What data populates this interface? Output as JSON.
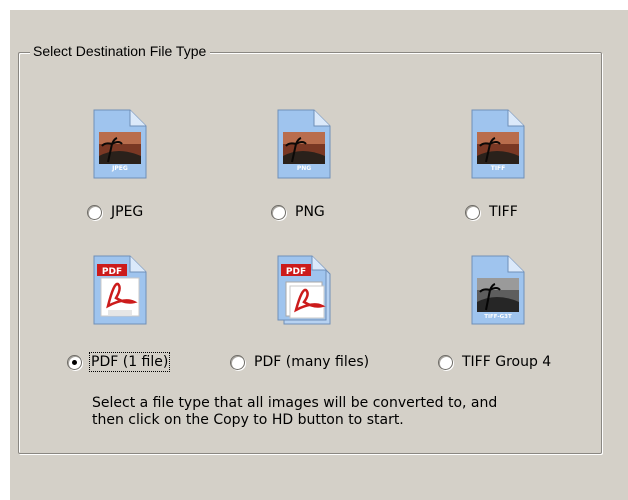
{
  "group": {
    "title": "Select Destination File Type"
  },
  "options": [
    {
      "label": "JPEG",
      "icon": "jpeg-file-icon",
      "icon_caption": "JPEG",
      "selected": false
    },
    {
      "label": "PNG",
      "icon": "png-file-icon",
      "icon_caption": "PNG",
      "selected": false
    },
    {
      "label": "TIFF",
      "icon": "tiff-file-icon",
      "icon_caption": "TIFF",
      "selected": false
    },
    {
      "label": "PDF (1 file)",
      "icon": "pdf-file-icon",
      "icon_caption": "PDF",
      "selected": true
    },
    {
      "label": "PDF (many files)",
      "icon": "pdf-multiple-files-icon",
      "icon_caption": "PDF",
      "selected": false
    },
    {
      "label": "TIFF Group 4",
      "icon": "tiff-g4-file-icon",
      "icon_caption": "TIFF-G3T",
      "selected": false
    }
  ],
  "hint": {
    "line1": "Select a file type that all images will be converted to, and",
    "line2": "then click on the Copy to HD button to start."
  },
  "colors": {
    "window_background": "#d4d0c8",
    "pdf_red": "#cc1b1b",
    "file_blue": "#8fb7e8"
  }
}
